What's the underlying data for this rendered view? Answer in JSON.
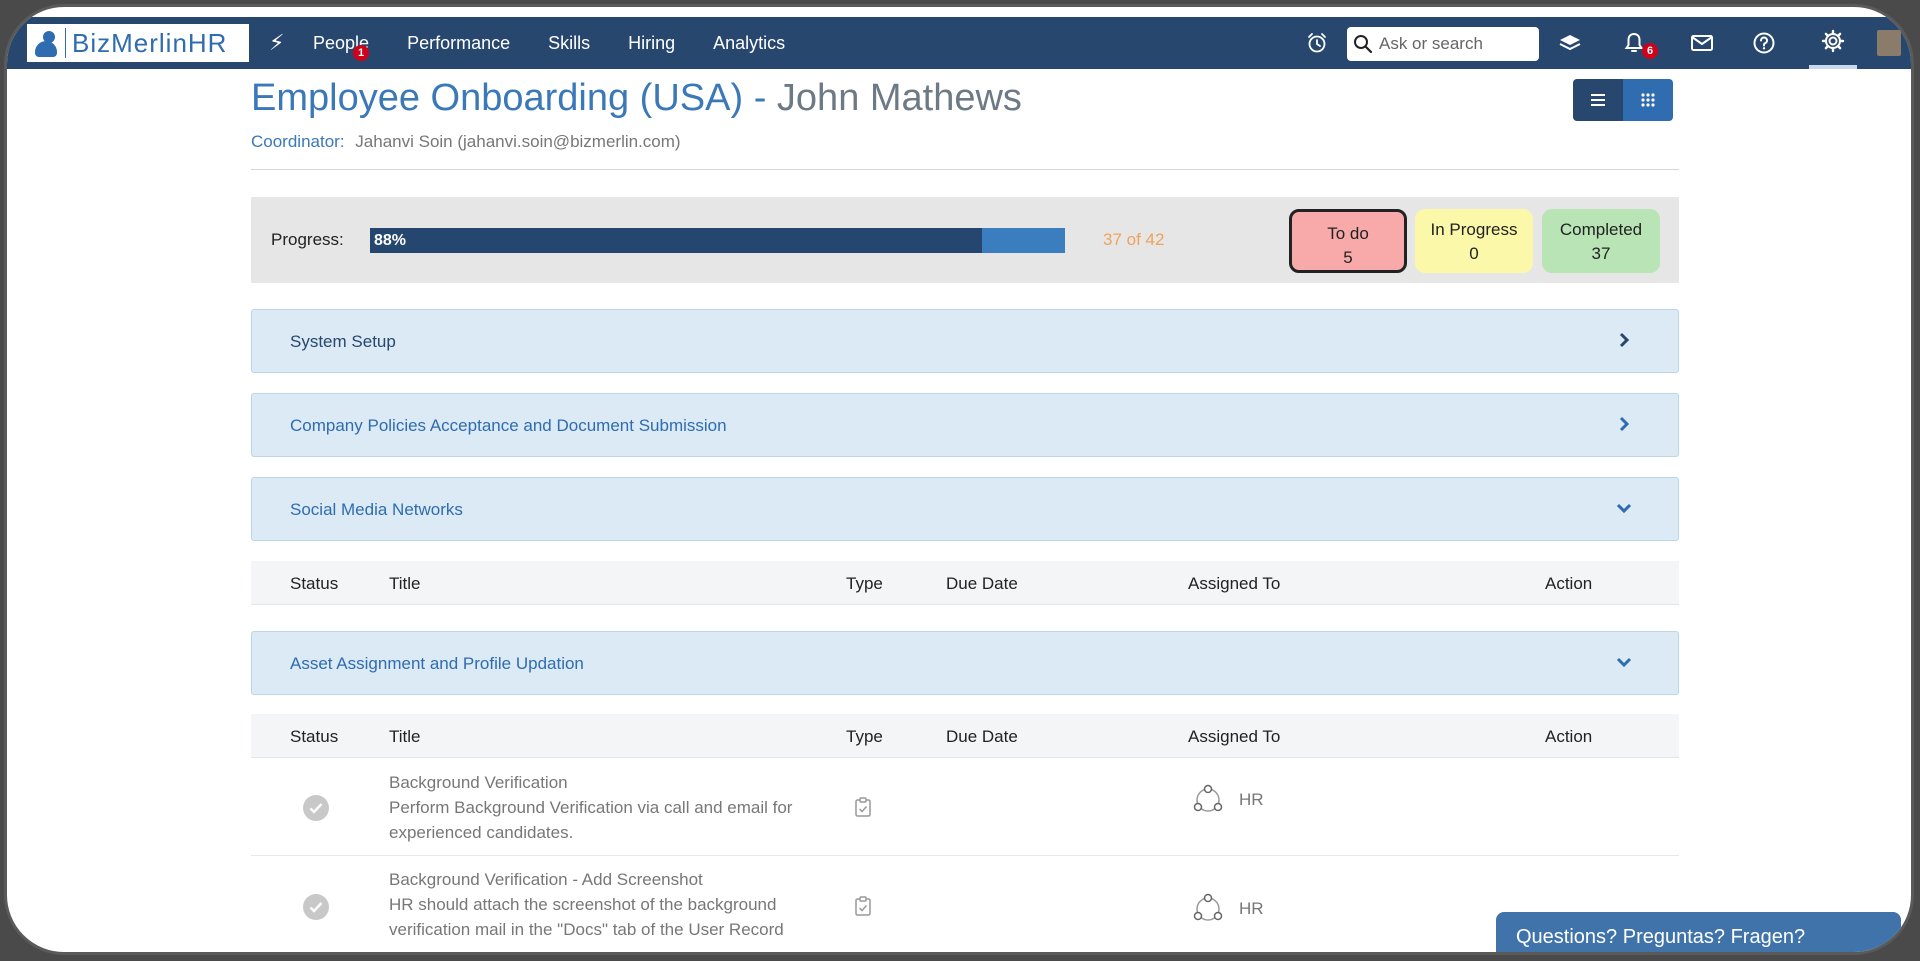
{
  "brand": {
    "name": "BizMerlinHR"
  },
  "nav": {
    "items": [
      {
        "label": "People",
        "badge": "1"
      },
      {
        "label": "Performance"
      },
      {
        "label": "Skills"
      },
      {
        "label": "Hiring"
      },
      {
        "label": "Analytics"
      }
    ],
    "search_placeholder": "Ask or search",
    "notification_count": "6"
  },
  "page": {
    "title": "Employee Onboarding (USA)",
    "separator": " - ",
    "employee": "John Mathews",
    "coordinator_label": "Coordinator:",
    "coordinator": "Jahanvi Soin (jahanvi.soin@bizmerlin.com)"
  },
  "progress": {
    "label": "Progress:",
    "percent_text": "88%",
    "fraction": 0.88,
    "count_text": "37 of 42",
    "stats": [
      {
        "label": "To do",
        "value": "5"
      },
      {
        "label": "In Progress",
        "value": "0"
      },
      {
        "label": "Completed",
        "value": "37"
      }
    ]
  },
  "sections": [
    {
      "title": "System Setup",
      "state": "collapsed"
    },
    {
      "title": "Company Policies Acceptance and Document Submission",
      "state": "collapsed"
    },
    {
      "title": "Social Media Networks",
      "state": "expanded"
    },
    {
      "title": "Asset Assignment and Profile Updation",
      "state": "expanded"
    }
  ],
  "table": {
    "headers": [
      "Status",
      "Title",
      "Type",
      "Due Date",
      "Assigned To",
      "Action"
    ]
  },
  "tasks": [
    {
      "title": "Background Verification",
      "description": "Perform Background Verification via call and email for experienced candidates.",
      "assigned_to": "HR",
      "status": "completed"
    },
    {
      "title": "Background Verification - Add Screenshot",
      "description": "HR should attach the screenshot of the background verification mail in the \"Docs\" tab of the User Record",
      "assigned_to": "HR",
      "status": "completed"
    }
  ],
  "help": {
    "label": "Questions? Preguntas? Fragen?"
  },
  "colors": {
    "nav_bg": "#27476e",
    "accent": "#3a78b8",
    "todo": "#f8aaaa",
    "in_progress": "#fbf8a9",
    "completed": "#b9e4b5",
    "section_bg": "#dbeaf4"
  }
}
